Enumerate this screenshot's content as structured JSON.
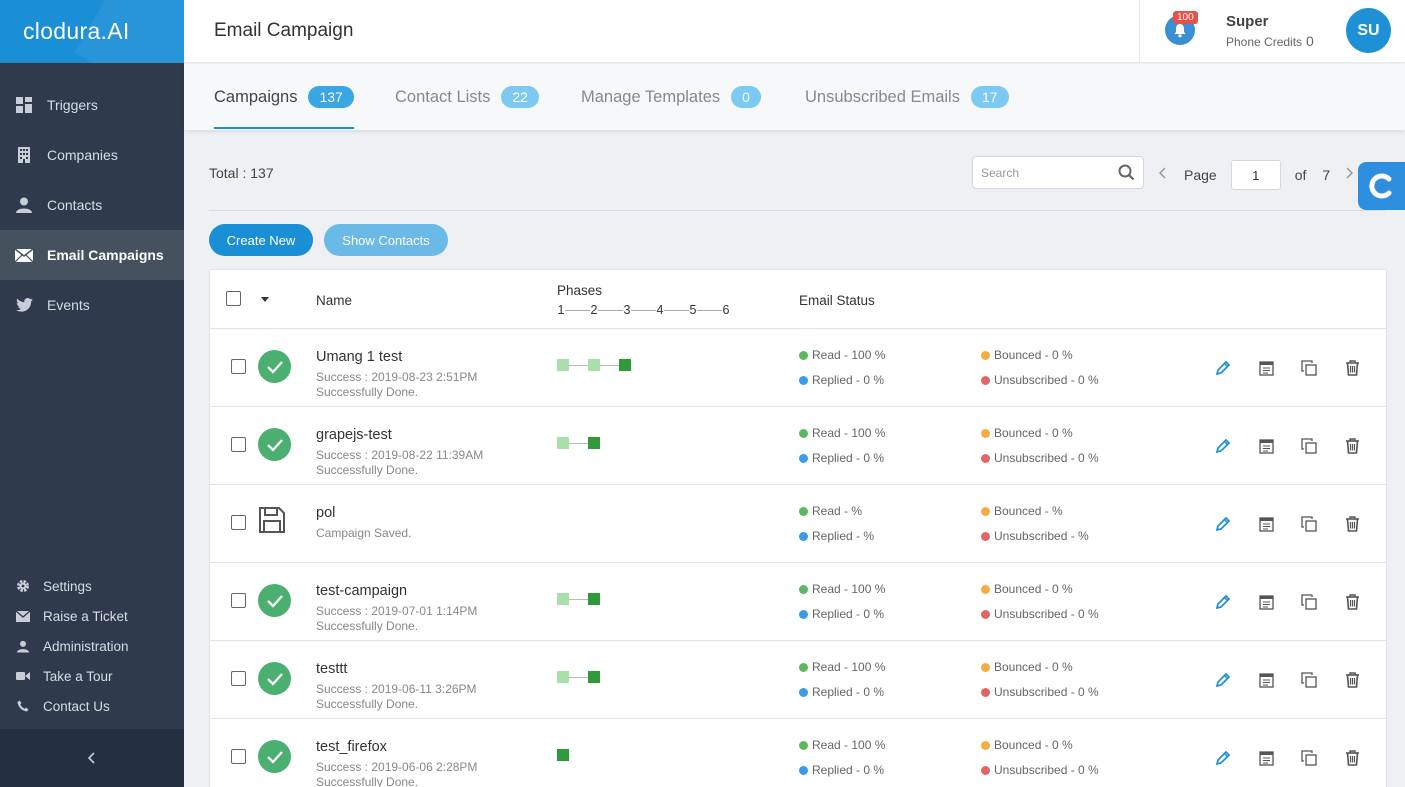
{
  "brand": {
    "logo": "clodura.AI"
  },
  "sidebar": {
    "items": [
      {
        "label": "Triggers",
        "icon": "grid-icon"
      },
      {
        "label": "Companies",
        "icon": "building-icon"
      },
      {
        "label": "Contacts",
        "icon": "person-icon"
      },
      {
        "label": "Email Campaigns",
        "icon": "envelope-icon",
        "active": true
      },
      {
        "label": "Events",
        "icon": "twitter-icon"
      }
    ],
    "bottom_items": [
      {
        "label": "Settings",
        "icon": "gear-icon"
      },
      {
        "label": "Raise a Ticket",
        "icon": "envelope-icon"
      },
      {
        "label": "Administration",
        "icon": "person-icon"
      },
      {
        "label": "Take a Tour",
        "icon": "video-icon"
      },
      {
        "label": "Contact Us",
        "icon": "phone-icon"
      }
    ]
  },
  "header": {
    "title": "Email Campaign",
    "notifications": "100",
    "user_name": "Super",
    "credits_label": "Phone Credits",
    "credits_value": "0",
    "avatar": "SU"
  },
  "tabs": [
    {
      "label": "Campaigns",
      "count": "137",
      "active": true
    },
    {
      "label": "Contact Lists",
      "count": "22"
    },
    {
      "label": "Manage Templates",
      "count": "0"
    },
    {
      "label": "Unsubscribed Emails",
      "count": "17"
    }
  ],
  "toolbar": {
    "total": "Total : 137",
    "search_placeholder": "Search",
    "page_label": "Page",
    "page_value": "1",
    "of_label": "of",
    "page_total": "7",
    "create_label": "Create New",
    "show_label": "Show Contacts"
  },
  "table": {
    "col_name": "Name",
    "col_phases": "Phases",
    "phase_numbers": [
      "1",
      "2",
      "3",
      "4",
      "5",
      "6"
    ],
    "col_status": "Email Status",
    "rows": [
      {
        "name": "Umang 1 test",
        "sub1": "Success : 2019-08-23   2:51PM",
        "sub2": "Successfully Done.",
        "status": "success",
        "phases": [
          "light",
          "light",
          "dark"
        ],
        "read": "Read - 100 %",
        "replied": "Replied - 0 %",
        "bounced": "Bounced - 0 %",
        "unsub": "Unsubscribed - 0 %"
      },
      {
        "name": "grapejs-test",
        "sub1": "Success : 2019-08-22   11:39AM",
        "sub2": "Successfully Done.",
        "status": "success",
        "phases": [
          "light",
          "dark"
        ],
        "read": "Read - 100 %",
        "replied": "Replied - 0 %",
        "bounced": "Bounced - 0 %",
        "unsub": "Unsubscribed - 0 %"
      },
      {
        "name": "pol",
        "sub1": "Campaign Saved.",
        "sub2": "",
        "status": "saved",
        "phases": [],
        "read": "Read - %",
        "replied": "Replied - %",
        "bounced": "Bounced - %",
        "unsub": "Unsubscribed - %"
      },
      {
        "name": "test-campaign",
        "sub1": "Success : 2019-07-01   1:14PM",
        "sub2": "Successfully Done.",
        "status": "success",
        "phases": [
          "light",
          "dark"
        ],
        "read": "Read - 100 %",
        "replied": "Replied - 0 %",
        "bounced": "Bounced - 0 %",
        "unsub": "Unsubscribed - 0 %"
      },
      {
        "name": "testtt",
        "sub1": "Success : 2019-06-11   3:26PM",
        "sub2": "Successfully Done.",
        "status": "success",
        "phases": [
          "light",
          "dark"
        ],
        "read": "Read - 100 %",
        "replied": "Replied - 0 %",
        "bounced": "Bounced - 0 %",
        "unsub": "Unsubscribed - 0 %"
      },
      {
        "name": "test_firefox",
        "sub1": "Success : 2019-06-06   2:28PM",
        "sub2": "Successfully Done.",
        "status": "success",
        "phases": [
          "dark"
        ],
        "read": "Read - 100 %",
        "replied": "Replied - 0 %",
        "bounced": "Bounced - 0 %",
        "unsub": "Unsubscribed - 0 %"
      }
    ]
  },
  "colors": {
    "brand": "#1b8fd6",
    "read": "#5cb85c",
    "replied": "#3a9be8",
    "bounced": "#f5ad42",
    "unsubscribed": "#e06666"
  }
}
